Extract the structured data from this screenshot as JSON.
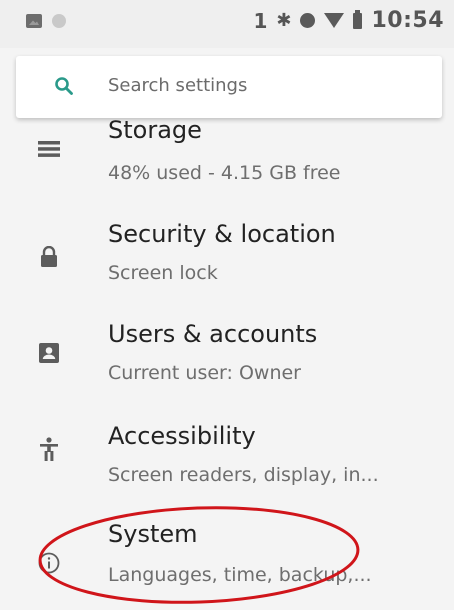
{
  "status_bar": {
    "notification_count": "1",
    "time": "10:54",
    "icons": [
      "image-icon",
      "dot-icon",
      "bluetooth-icon",
      "data-saver-icon",
      "wifi-icon",
      "battery-icon"
    ]
  },
  "search": {
    "placeholder": "Search settings",
    "accent_color": "#2a9a8a"
  },
  "settings_items": [
    {
      "icon": "storage-icon",
      "title": "Storage",
      "subtitle": "48% used - 4.15 GB free"
    },
    {
      "icon": "lock-icon",
      "title": "Security & location",
      "subtitle": "Screen lock"
    },
    {
      "icon": "account-box-icon",
      "title": "Users & accounts",
      "subtitle": "Current user: Owner"
    },
    {
      "icon": "accessibility-icon",
      "title": "Accessibility",
      "subtitle": "Screen readers, display, in..."
    },
    {
      "icon": "info-icon",
      "title": "System",
      "subtitle": "Languages, time, backup,..."
    }
  ],
  "annotation_color": "#d0151a"
}
